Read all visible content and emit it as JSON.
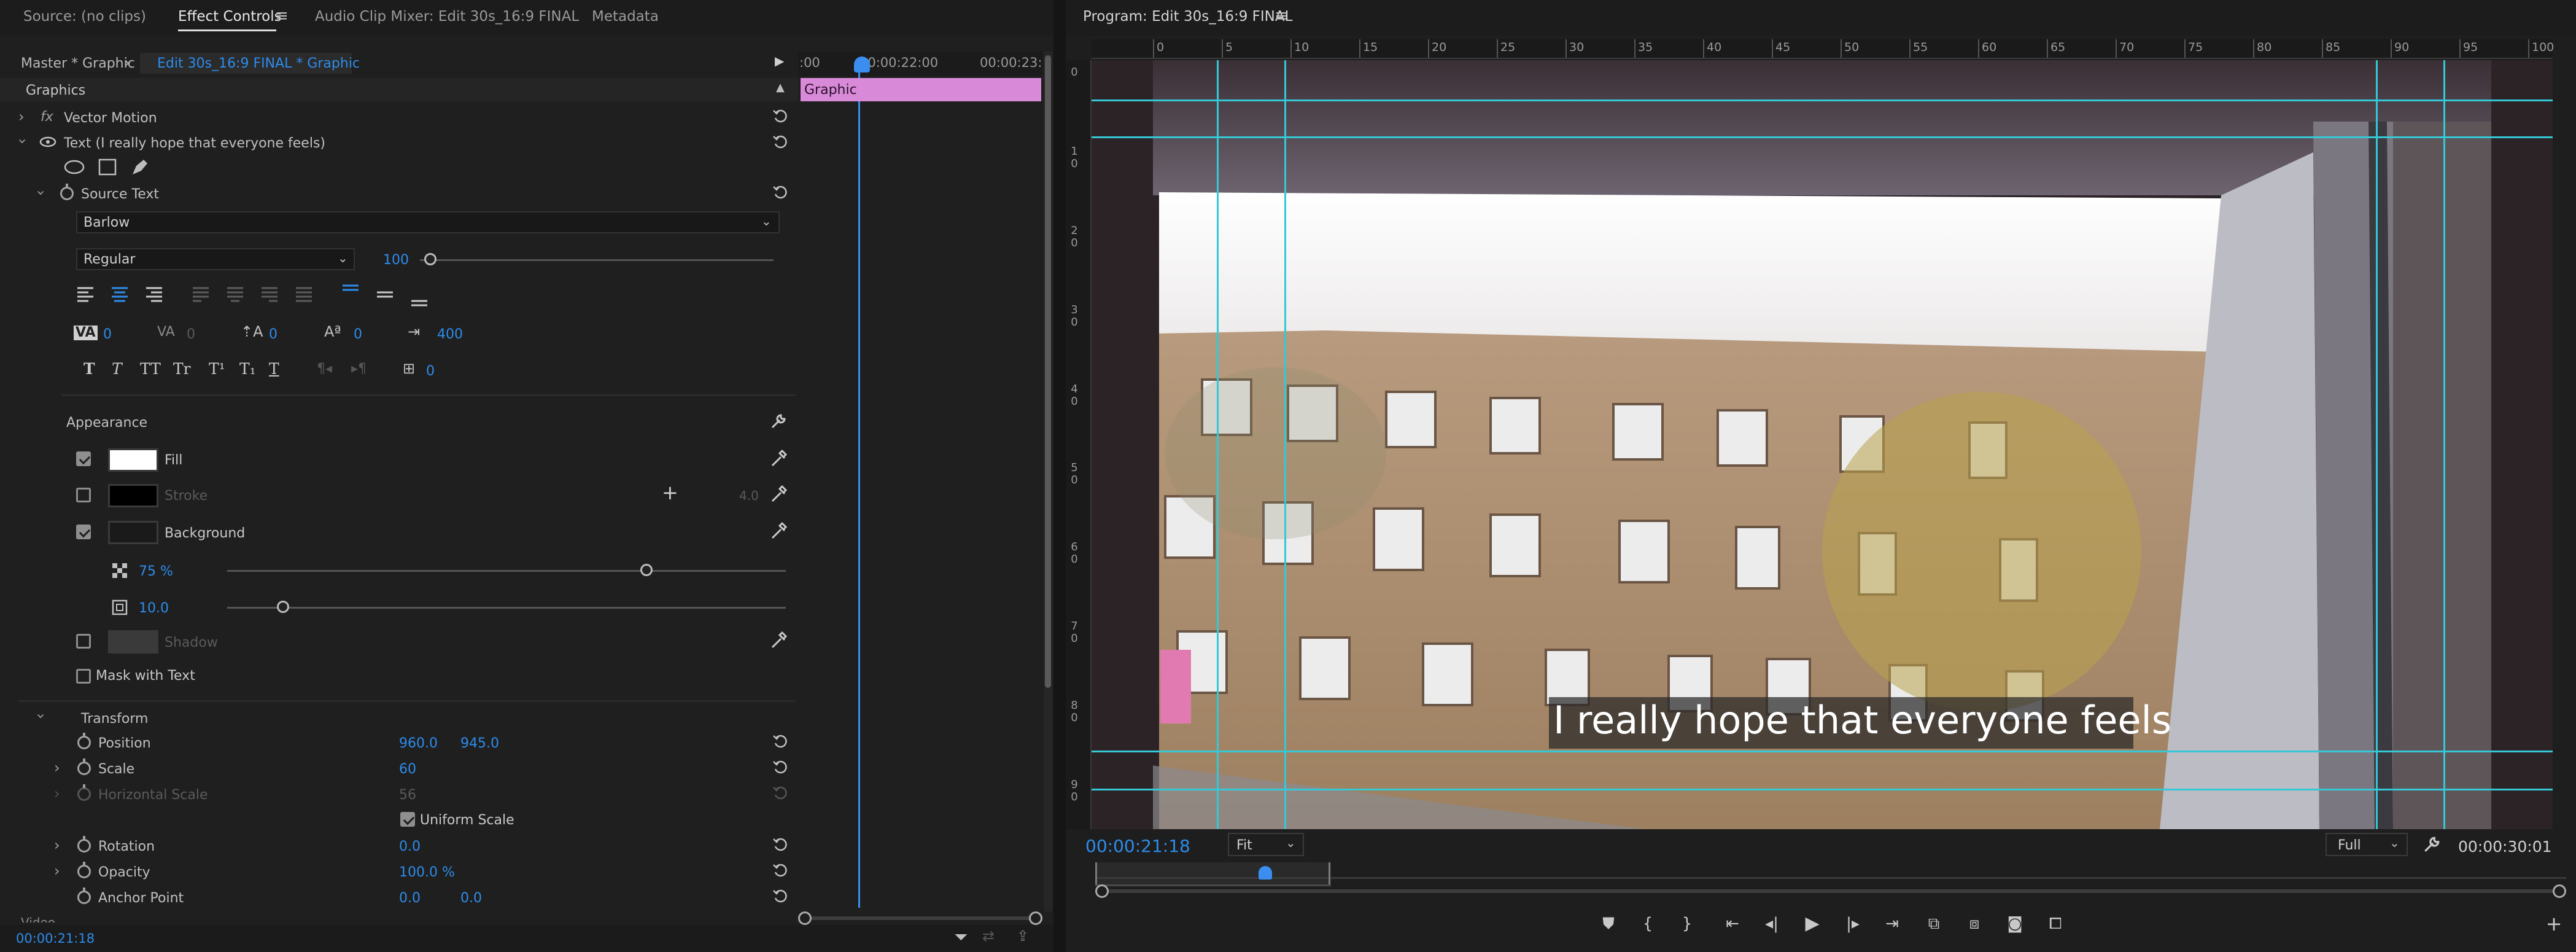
{
  "left_tabs": {
    "source": "Source: (no clips)",
    "effect_controls": "Effect Controls",
    "audio_mixer": "Audio Clip Mixer: Edit 30s_16:9 FINAL",
    "metadata": "Metadata",
    "menu_icon": "hamburger-icon"
  },
  "clip_header": {
    "master": "Master * Graphic",
    "sequence": "Edit 30s_16:9 FINAL * Graphic",
    "ruler_start": ":00",
    "ruler_mid": "00:00:22:00",
    "ruler_end": "00:00:23:"
  },
  "graphics": {
    "section": "Graphics",
    "vector_motion": "Vector Motion",
    "fx": "fx",
    "text_layer": "Text (I really hope that everyone feels)",
    "source_text": "Source Text",
    "font": "Barlow",
    "font_style": "Regular",
    "font_size": "100",
    "font_size_fraction": 0.03,
    "kerning": "0",
    "tracking": "0",
    "leading": "0",
    "baseline": "0",
    "tab_width": "400",
    "tsume": "0",
    "style_buttons": [
      "T",
      "T",
      "TT",
      "Tr",
      "T¹",
      "T₁",
      "T"
    ]
  },
  "appearance": {
    "title": "Appearance",
    "fill_label": "Fill",
    "fill_checked": true,
    "fill_color": "#ffffff",
    "stroke_label": "Stroke",
    "stroke_checked": false,
    "stroke_color": "#000000",
    "stroke_width": "4.0",
    "background_label": "Background",
    "background_checked": true,
    "bg_opacity": "75 %",
    "bg_opacity_fraction": 0.75,
    "bg_size": "10.0",
    "bg_size_fraction": 0.1,
    "shadow_label": "Shadow",
    "shadow_checked": false,
    "mask_label": "Mask with Text",
    "mask_checked": false
  },
  "transform": {
    "title": "Transform",
    "position_label": "Position",
    "position_x": "960.0",
    "position_y": "945.0",
    "scale_label": "Scale",
    "scale": "60",
    "hscale_label": "Horizontal Scale",
    "hscale": "56",
    "uniform_label": "Uniform Scale",
    "uniform_checked": true,
    "rotation_label": "Rotation",
    "rotation": "0.0",
    "opacity_label": "Opacity",
    "opacity": "100.0 %",
    "anchor_label": "Anchor Point",
    "anchor_x": "0.0",
    "anchor_y": "0.0",
    "video_cut": "Video"
  },
  "timeline_clip": {
    "label": "Graphic",
    "color": "#d88ad8"
  },
  "left_footer": {
    "timecode": "00:00:21:18"
  },
  "program": {
    "title": "Program: Edit 30s_16:9 FINAL",
    "ruler_labels": [
      "0",
      "5",
      "10",
      "15",
      "20",
      "25",
      "30",
      "35",
      "40",
      "45",
      "50",
      "55",
      "60",
      "65",
      "70",
      "75",
      "80",
      "85",
      "90",
      "95",
      "100"
    ],
    "vruler_labels": [
      "0",
      "1 0",
      "2 0",
      "3 0",
      "4 0",
      "5 0",
      "6 0",
      "7 0",
      "8 0",
      "9 0"
    ],
    "subtitle": "I really hope that everyone feels",
    "timecode": "00:00:21:18",
    "fit": "Fit",
    "quality": "Full",
    "duration": "00:00:30:01",
    "guide_color": "#35c8d6"
  },
  "transport": {
    "buttons": [
      "marker-icon",
      "mark-in-icon",
      "mark-out-icon",
      "go-to-in-icon",
      "step-back-icon",
      "play-icon",
      "step-forward-icon",
      "go-to-out-icon",
      "insert-icon",
      "overwrite-icon",
      "export-frame-icon",
      "comparison-view-icon"
    ],
    "add_icon": "plus-icon"
  }
}
